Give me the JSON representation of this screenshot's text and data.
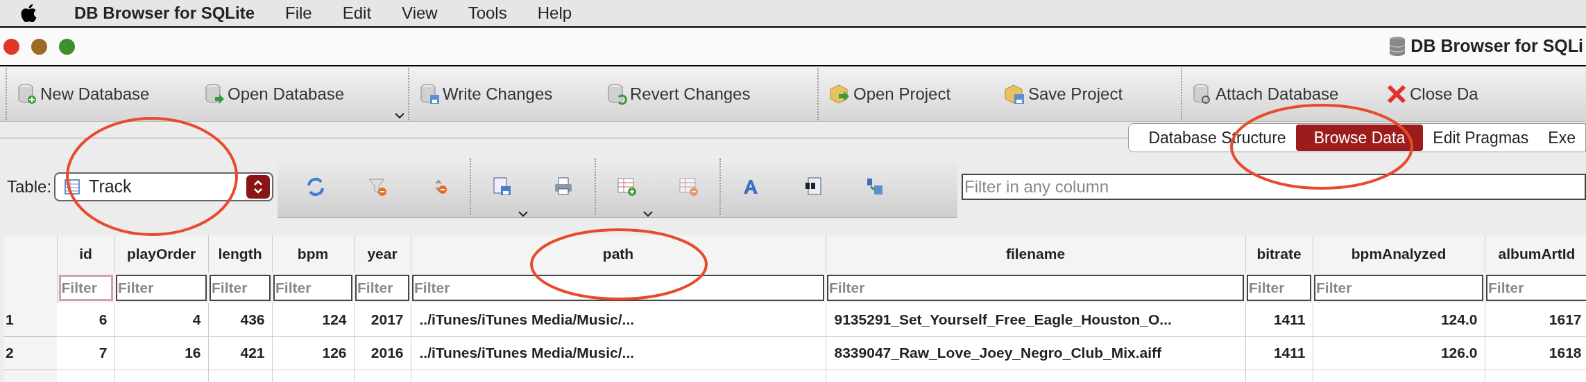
{
  "menu_bar": {
    "app_name": "DB Browser for SQLite",
    "menus": [
      "File",
      "Edit",
      "View",
      "Tools",
      "Help"
    ]
  },
  "window": {
    "title": "DB Browser for SQLi"
  },
  "toolbar": [
    {
      "label": "New Database",
      "dropdown": false,
      "group_start": true
    },
    {
      "label": "Open Database",
      "dropdown": true,
      "group_start": false
    },
    {
      "label": "Write Changes",
      "dropdown": false,
      "group_start": true
    },
    {
      "label": "Revert Changes",
      "dropdown": false,
      "group_start": false
    },
    {
      "label": "Open Project",
      "dropdown": false,
      "group_start": true
    },
    {
      "label": "Save Project",
      "dropdown": false,
      "group_start": false
    },
    {
      "label": "Attach Database",
      "dropdown": false,
      "group_start": true
    },
    {
      "label": "Close Da",
      "dropdown": false,
      "group_start": false
    }
  ],
  "tabs": [
    {
      "label": "Database Structure",
      "selected": false
    },
    {
      "label": "Browse Data",
      "selected": true
    },
    {
      "label": "Edit Pragmas",
      "selected": false
    },
    {
      "label": "Exe",
      "selected": false
    }
  ],
  "table_selector": {
    "label": "Table:",
    "value": "Track"
  },
  "filter_field": {
    "placeholder": "Filter in any column"
  },
  "table": {
    "columns": [
      {
        "label": "id",
        "kind": "number",
        "placeholder": "Filter",
        "focused": true
      },
      {
        "label": "playOrder",
        "kind": "number",
        "placeholder": "Filter",
        "focused": false
      },
      {
        "label": "length",
        "kind": "number",
        "placeholder": "Filter",
        "focused": false
      },
      {
        "label": "bpm",
        "kind": "number",
        "placeholder": "Filter",
        "focused": false
      },
      {
        "label": "year",
        "kind": "number",
        "placeholder": "Filter",
        "focused": false
      },
      {
        "label": "path",
        "kind": "text",
        "placeholder": "Filter",
        "focused": false
      },
      {
        "label": "filename",
        "kind": "text",
        "placeholder": "Filter",
        "focused": false
      },
      {
        "label": "bitrate",
        "kind": "number",
        "placeholder": "Filter",
        "focused": false
      },
      {
        "label": "bpmAnalyzed",
        "kind": "number",
        "placeholder": "Filter",
        "focused": false
      },
      {
        "label": "albumArtId",
        "kind": "number",
        "placeholder": "Filter",
        "focused": false
      }
    ],
    "rows": [
      {
        "row_number": "1",
        "cells": [
          "6",
          "4",
          "436",
          "124",
          "2017",
          "../iTunes/iTunes Media/Music/...",
          "9135291_Set_Yourself_Free_Eagle_Houston_O...",
          "1411",
          "124.0",
          "1617"
        ]
      },
      {
        "row_number": "2",
        "cells": [
          "7",
          "16",
          "421",
          "126",
          "2016",
          "../iTunes/iTunes Media/Music/...",
          "8339047_Raw_Love_Joey_Negro_Club_Mix.aiff",
          "1411",
          "126.0",
          "1618"
        ]
      }
    ]
  }
}
